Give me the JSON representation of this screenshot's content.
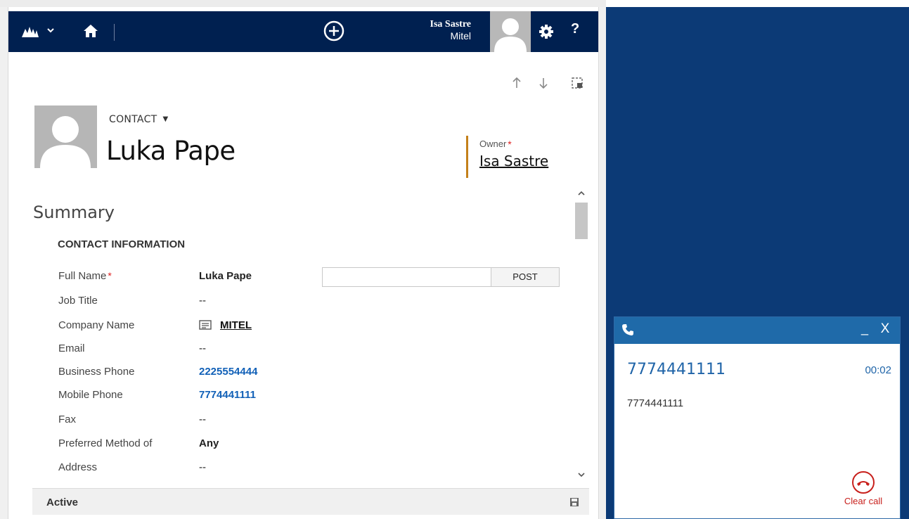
{
  "navbar": {
    "user_name": "Isa Sastre",
    "user_org": "Mitel",
    "help_label": "?",
    "icons": [
      "dynamics-logo-icon",
      "chevron-down-icon",
      "home-icon",
      "plus-circle-icon",
      "avatar-icon",
      "gear-icon"
    ]
  },
  "record": {
    "entity_label": "CONTACT",
    "name": "Luka Pape",
    "owner_label": "Owner",
    "owner_required": "*",
    "owner_value": "Isa Sastre"
  },
  "summary": {
    "title": "Summary",
    "section_title": "CONTACT INFORMATION",
    "fields": [
      {
        "label": "Full Name",
        "required": "*",
        "value": "Luka Pape"
      },
      {
        "label": "Job Title",
        "value": "--"
      },
      {
        "label": "Company Name",
        "value": "MITEL"
      },
      {
        "label": "Email",
        "value": "--"
      },
      {
        "label": "Business Phone",
        "value": "2225554444"
      },
      {
        "label": "Mobile Phone",
        "value": "7774441111"
      },
      {
        "label": "Fax",
        "value": "--"
      },
      {
        "label": "Preferred Method of",
        "value": "Any"
      },
      {
        "label": "Address",
        "value": "--"
      }
    ],
    "post_button": "POST"
  },
  "status": {
    "text": "Active"
  },
  "call": {
    "number": "7774441111",
    "timer": "00:02",
    "subnumber": "7774441111",
    "minimize_label": "_",
    "close_label": "X",
    "clear_label": "Clear call",
    "colors": {
      "header": "#1f6aa9",
      "number": "#1f64a8",
      "hangup": "#c8201c"
    }
  },
  "colors": {
    "navbar": "#002050",
    "phone_bg": "#0c3a76",
    "owner_accent": "#c4801a",
    "link": "#1160b7"
  }
}
